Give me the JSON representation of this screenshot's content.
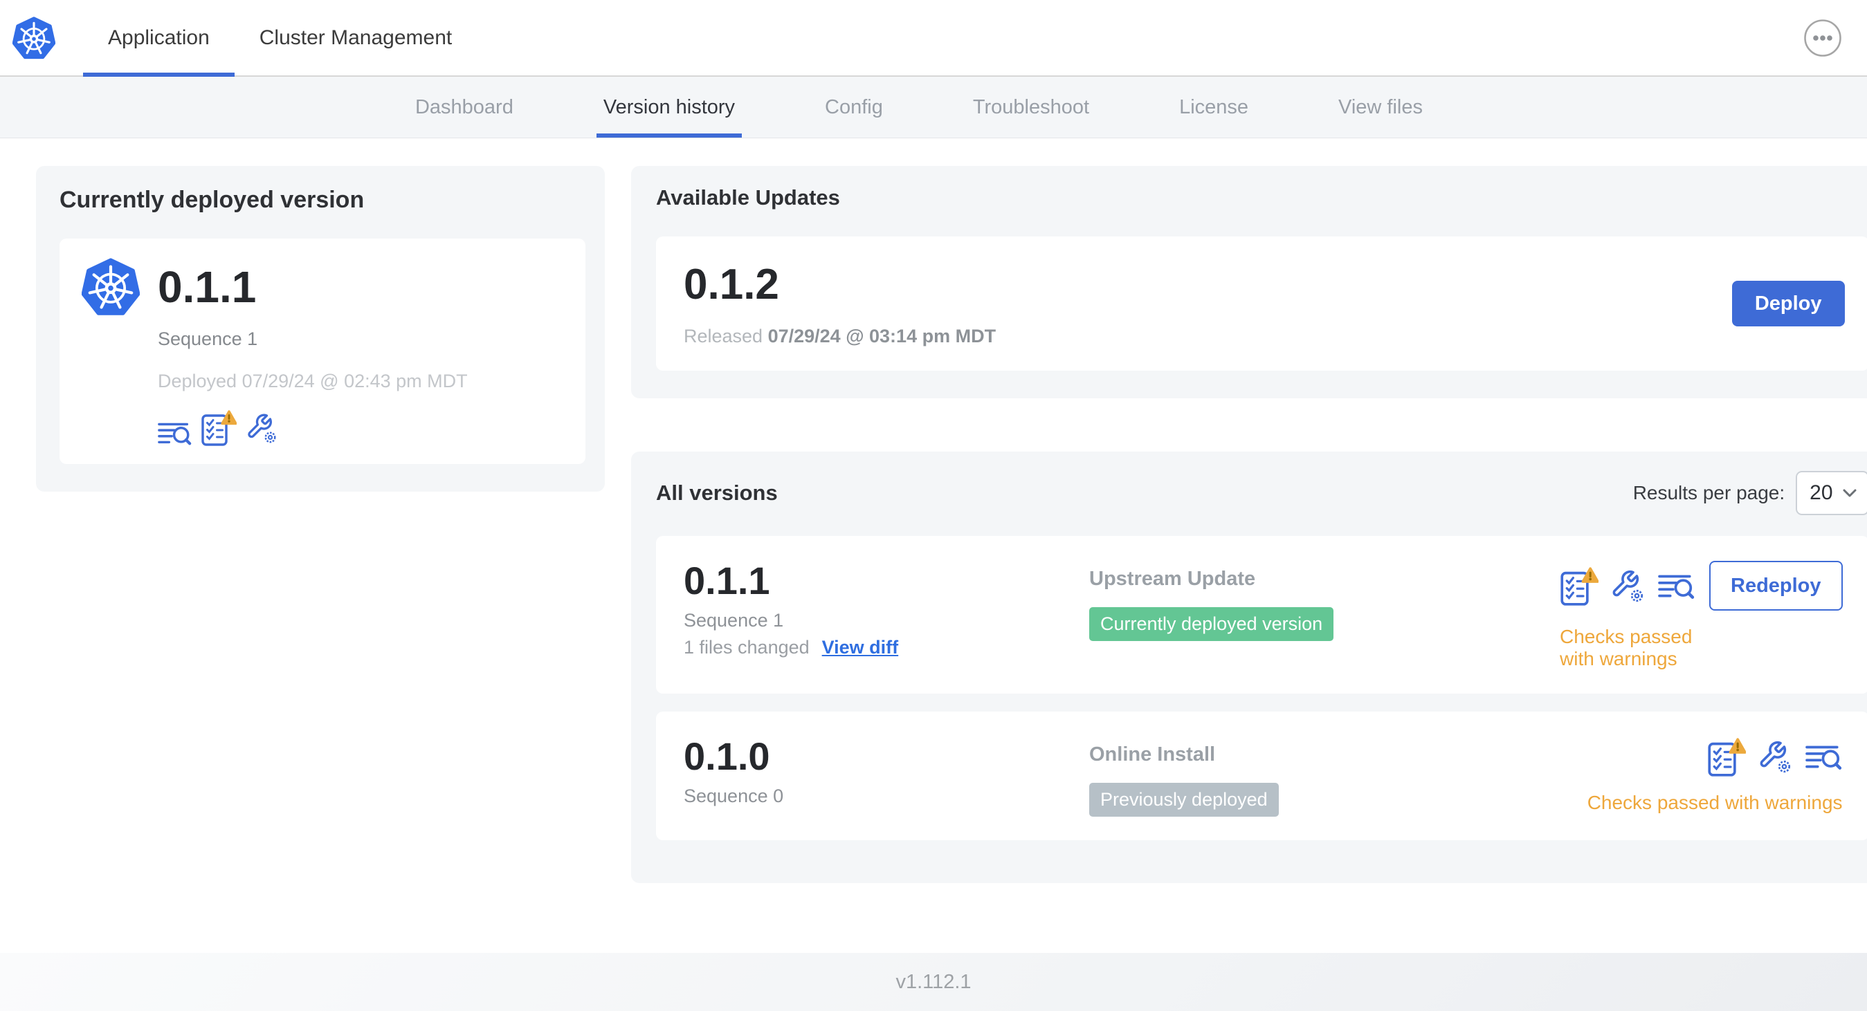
{
  "header": {
    "tabs": [
      {
        "label": "Application",
        "active": true
      },
      {
        "label": "Cluster Management",
        "active": false
      }
    ]
  },
  "nav": {
    "tabs": [
      {
        "label": "Dashboard",
        "active": false
      },
      {
        "label": "Version history",
        "active": true
      },
      {
        "label": "Config",
        "active": false
      },
      {
        "label": "Troubleshoot",
        "active": false
      },
      {
        "label": "License",
        "active": false
      },
      {
        "label": "View files",
        "active": false
      }
    ]
  },
  "current_version": {
    "title": "Currently deployed version",
    "version": "0.1.1",
    "sequence": "Sequence 1",
    "deployed": "Deployed 07/29/24 @ 02:43 pm MDT",
    "icons": [
      "diff-logs-icon",
      "preflight-checks-warning-icon",
      "config-wrench-icon"
    ]
  },
  "available_updates": {
    "title": "Available Updates",
    "version": "0.1.2",
    "released_prefix": "Released",
    "released_date": "07/29/24 @ 03:14 pm MDT",
    "deploy_label": "Deploy"
  },
  "all_versions": {
    "title": "All versions",
    "results_per_page_label": "Results per page:",
    "results_per_page_value": "20",
    "rows": [
      {
        "version": "0.1.1",
        "sequence": "Sequence 1",
        "files_changed": "1 files changed",
        "view_diff_label": "View diff",
        "source": "Upstream Update",
        "badge": "Currently deployed version",
        "badge_type": "green",
        "checks": "Checks passed with warnings",
        "action_label": "Redeploy",
        "icons": [
          "preflight-checks-warning-icon",
          "config-wrench-icon",
          "diff-logs-icon"
        ]
      },
      {
        "version": "0.1.0",
        "sequence": "Sequence 0",
        "source": "Online Install",
        "badge": "Previously deployed",
        "badge_type": "gray",
        "checks": "Checks passed with warnings",
        "icons": [
          "preflight-checks-warning-icon",
          "config-wrench-icon",
          "diff-logs-icon"
        ]
      }
    ]
  },
  "footer": {
    "version": "v1.112.1"
  },
  "colors": {
    "accent_blue": "#3e6bd6",
    "kubernetes_blue": "#326de6",
    "success_green": "#63c694",
    "muted_badge_gray": "#b6c0c7",
    "warning_orange": "#eea73b"
  }
}
